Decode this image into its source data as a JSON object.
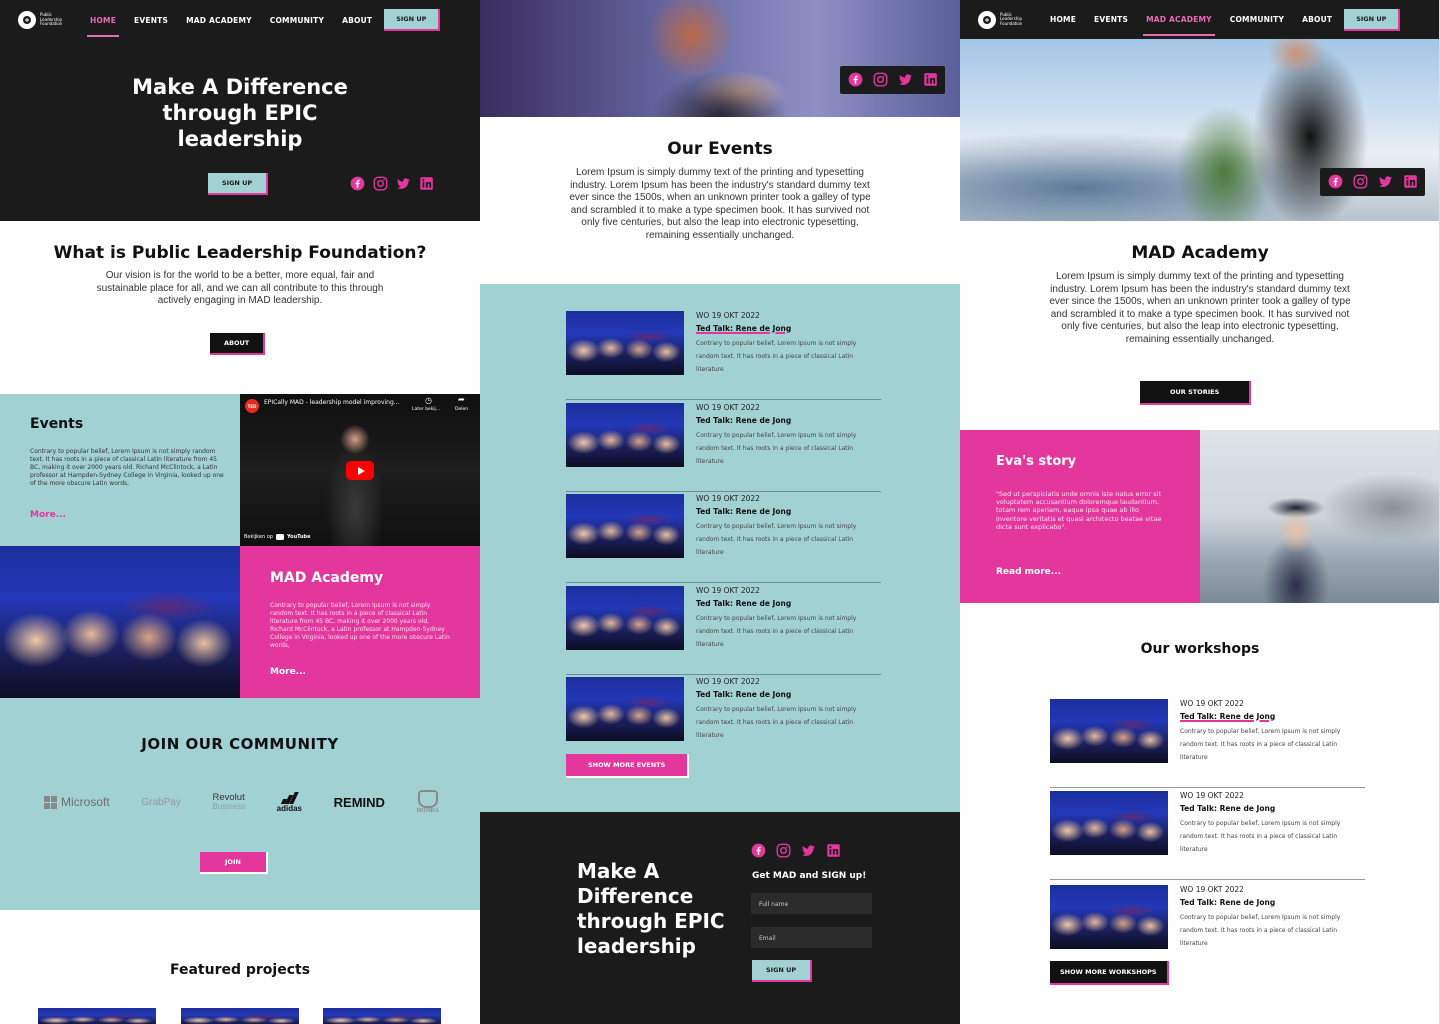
{
  "colors": {
    "pink": "#e3379e",
    "teal": "#a2d1d4",
    "dark": "#1b1b1b",
    "nav_active": "#e86bb6"
  },
  "logo": {
    "line1": "Public",
    "line2": "Leadership",
    "line3": "Foundation"
  },
  "nav": {
    "items": [
      "HOME",
      "EVENTS",
      "MAD ACADEMY",
      "COMMUNITY",
      "ABOUT"
    ],
    "signup_label": "SIGN UP"
  },
  "social_icons": [
    "facebook-icon",
    "instagram-icon",
    "twitter-icon",
    "linkedin-icon"
  ],
  "home": {
    "hero": {
      "line1": "Make A Difference",
      "line2": "through EPIC",
      "line3": "leadership",
      "signup": "SIGN UP"
    },
    "what": {
      "title": "What is Public Leadership Foundation?",
      "text": "Our vision is for the world to be a better, more equal, fair and sustainable place for all, and we can all contribute to this through actively engaging in MAD leadership.",
      "button": "ABOUT"
    },
    "events_tile": {
      "title": "Events",
      "text": "Contrary to popular belief, Lorem Ipsum is not simply random text. It has roots in a piece of classical Latin literature from 45 BC, making it over 2000 years old. Richard McClintock, a Latin professor at Hampden-Sydney College in Virginia, looked up one of the more obscure Latin words,",
      "more": "More..."
    },
    "video": {
      "title": "EPICally MAD - leadership model improving...",
      "later": "Later bekij...",
      "share": "Delen",
      "watch_on": "Bekijken op",
      "youtube": "YouTube"
    },
    "mad_tile": {
      "title": "MAD Academy",
      "text": "Contrary to popular belief, Lorem Ipsum is not simply random text. It has roots in a piece of classical Latin literature from 45 BC, making it over 2000 years old. Richard McClintock, a Latin professor at Hampden-Sydney College in Virginia, looked up one of the more obscure Latin words,",
      "more": "More..."
    },
    "community": {
      "title": "JOIN OUR COMMUNITY",
      "brands": [
        "Microsoft",
        "GrabPay",
        "Revolut",
        "Business",
        "adidas",
        "REMIND",
        "HONDA"
      ],
      "join": "JOIN"
    },
    "featured": {
      "title": "Featured projects"
    }
  },
  "events_page": {
    "title": "Our Events",
    "text": "Lorem Ipsum is simply dummy text of the printing and typesetting industry. Lorem Ipsum has been the industry's standard dummy text ever since the 1500s, when an unknown printer took a galley of type and scrambled it to make a type specimen book. It has survived not only five centuries, but also the leap into electronic typesetting, remaining essentially unchanged.",
    "events": [
      {
        "date": "WO 19 OKT 2022",
        "title": "Ted Talk: Rene de Jong",
        "desc": "Contrary to popular belief, Lorem Ipsum is not simply random text. It has roots in a piece of classical Latin literature"
      },
      {
        "date": "WO 19 OKT 2022",
        "title": "Ted Talk: Rene de Jong",
        "desc": "Contrary to popular belief, Lorem Ipsum is not simply random text. It has roots in a piece of classical Latin literature"
      },
      {
        "date": "WO 19 OKT 2022",
        "title": "Ted Talk: Rene de Jong",
        "desc": "Contrary to popular belief, Lorem Ipsum is not simply random text. It has roots in a piece of classical Latin literature"
      },
      {
        "date": "WO 19 OKT 2022",
        "title": "Ted Talk: Rene de Jong",
        "desc": "Contrary to popular belief, Lorem Ipsum is not simply random text. It has roots in a piece of classical Latin literature"
      },
      {
        "date": "WO 19 OKT 2022",
        "title": "Ted Talk: Rene de Jong",
        "desc": "Contrary to popular belief, Lorem Ipsum is not simply random text. It has roots in a piece of classical Latin literature"
      }
    ],
    "show_more": "SHOW MORE EVENTS",
    "footer": {
      "line1": "Make A",
      "line2": "Difference",
      "line3": "through EPIC",
      "line4": "leadership",
      "signup_title": "Get MAD and SIGN up!",
      "fullname_placeholder": "Full name",
      "email_placeholder": "Email",
      "signup": "SIGN UP"
    }
  },
  "academy_page": {
    "title": "MAD Academy",
    "text": "Lorem Ipsum is simply dummy text of the printing and typesetting industry. Lorem Ipsum has been the industry's standard dummy text ever since the 1500s, when an unknown printer took a galley of type and scrambled it to make a type specimen book. It has survived not only five centuries, but also the leap into electronic typesetting, remaining essentially unchanged.",
    "stories_button": "OUR STORIES",
    "story": {
      "title": "Eva's story",
      "quote": "\"Sed ut perspiciatis unde omnis iste natus error sit voluptatem accusantium doloremque laudantium, totam rem aperiam, eaque ipsa quae ab illo inventore veritatis et quasi architecto beatae vitae dicta sunt explicabo\".",
      "read_more": "Read more..."
    },
    "workshops_title": "Our workshops",
    "workshops": [
      {
        "date": "WO 19 OKT 2022",
        "title": "Ted Talk: Rene de Jong",
        "desc": "Contrary to popular belief, Lorem Ipsum is not simply random text. It has roots in a piece of classical Latin literature"
      },
      {
        "date": "WO 19 OKT 2022",
        "title": "Ted Talk: Rene de Jong",
        "desc": "Contrary to popular belief, Lorem Ipsum is not simply random text. It has roots in a piece of classical Latin literature"
      },
      {
        "date": "WO 19 OKT 2022",
        "title": "Ted Talk: Rene de Jong",
        "desc": "Contrary to popular belief, Lorem Ipsum is not simply random text. It has roots in a piece of classical Latin literature"
      }
    ],
    "show_more": "SHOW MORE WORKSHOPS"
  }
}
